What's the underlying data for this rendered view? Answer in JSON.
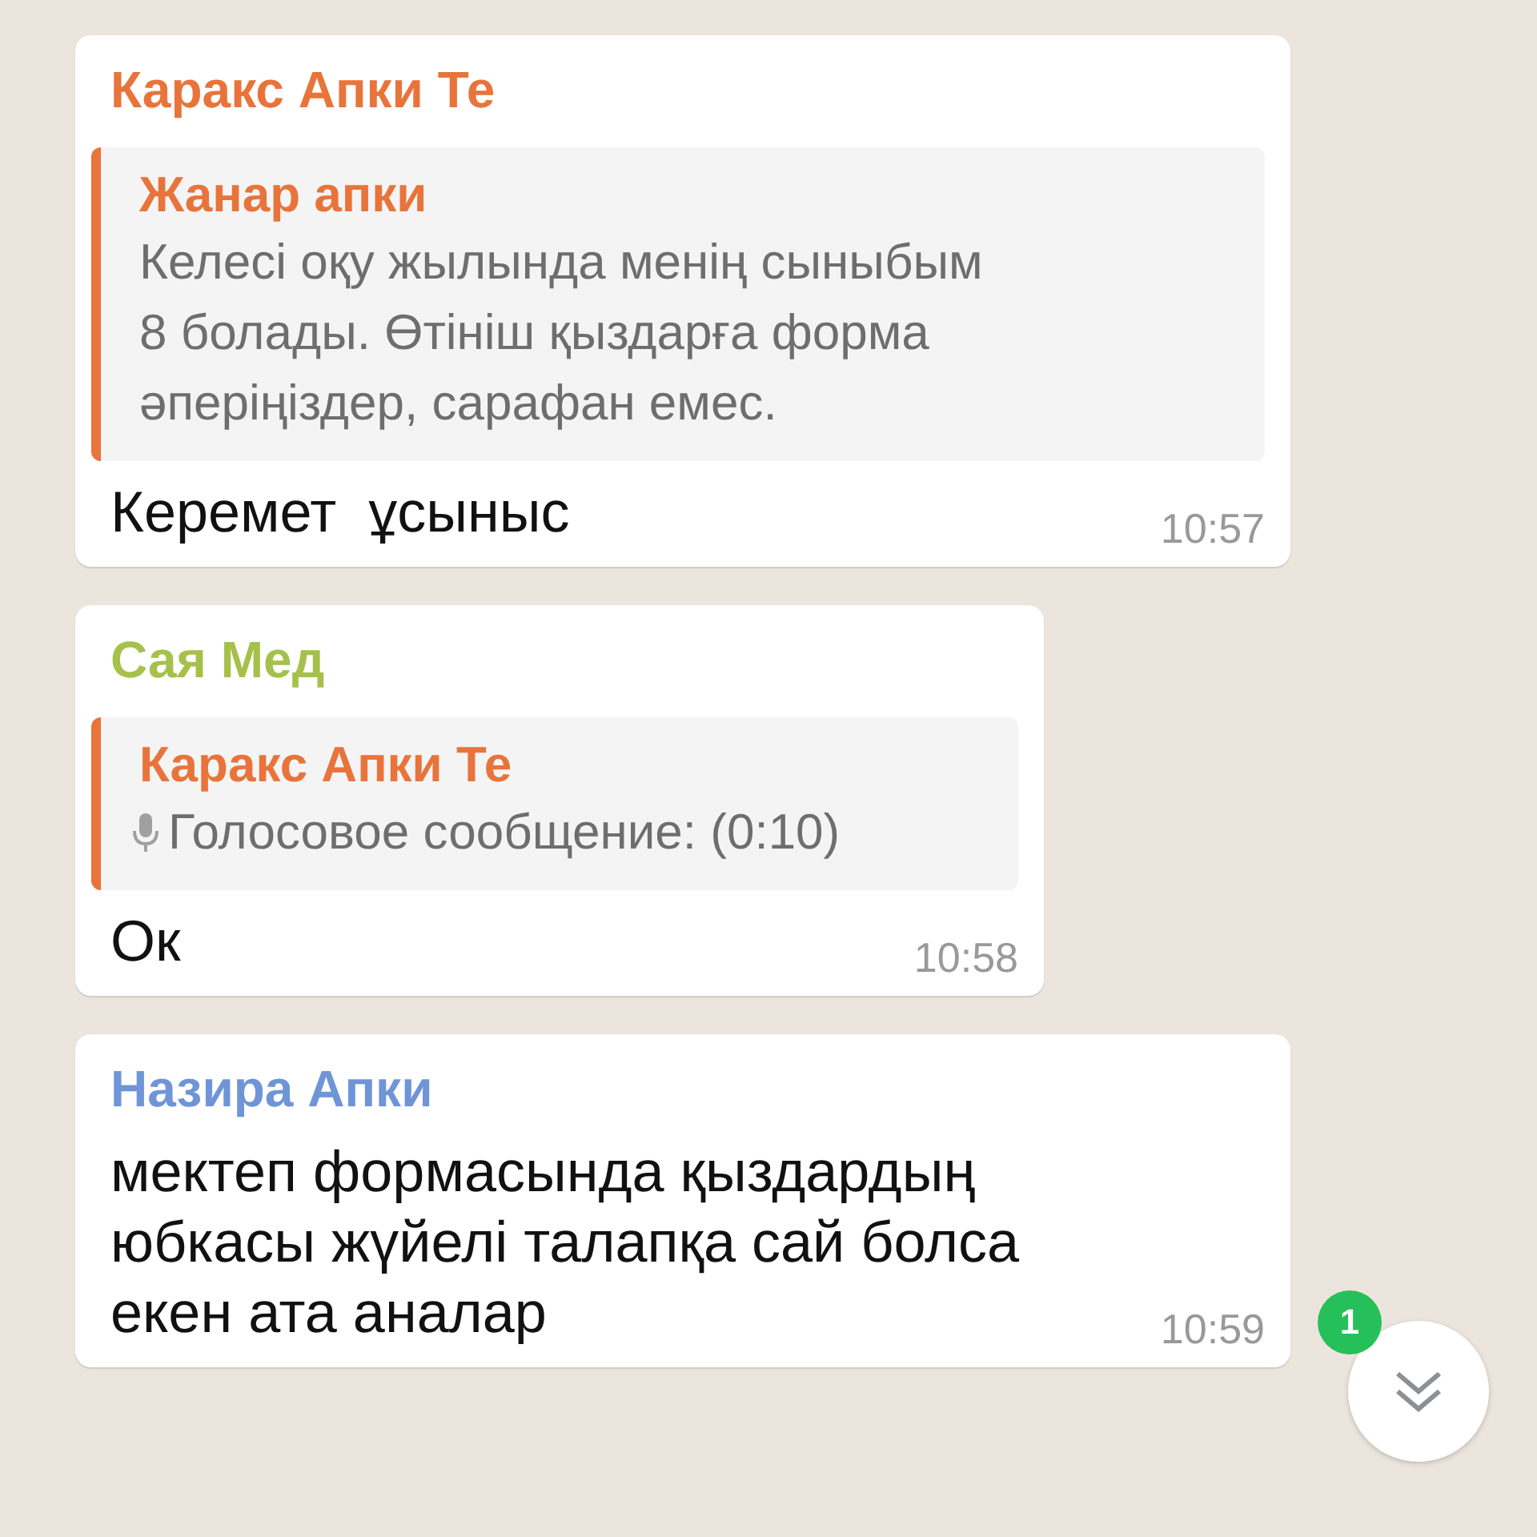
{
  "messages": [
    {
      "sender": "Каракс Апки Те",
      "color": "#e8743b",
      "quote": {
        "sender": "Жанар апки",
        "color": "#e8743b",
        "kind": "text",
        "text": "Келесі оқу жылында менің сыныбым\n8 болады. Өтініш қыздарға форма\nәперіңіздер, сарафан емес."
      },
      "text": "Керемет  ұсыныс",
      "time": "10:57"
    },
    {
      "sender": "Сая Мед",
      "color": "#a5c14a",
      "quote": {
        "sender": "Каракс Апки Те",
        "color": "#e8743b",
        "kind": "voice",
        "text": "Голосовое сообщение: (0:10)"
      },
      "text": "Ок",
      "time": "10:58"
    },
    {
      "sender": "Назира Апки",
      "color": "#6f95d8",
      "text": "мектеп формасында қыздардың\nюбкасы жүйелі талапқа сай болса\nекен ата аналар",
      "time": "10:59"
    }
  ],
  "scroll_button": {
    "badge": "1"
  }
}
